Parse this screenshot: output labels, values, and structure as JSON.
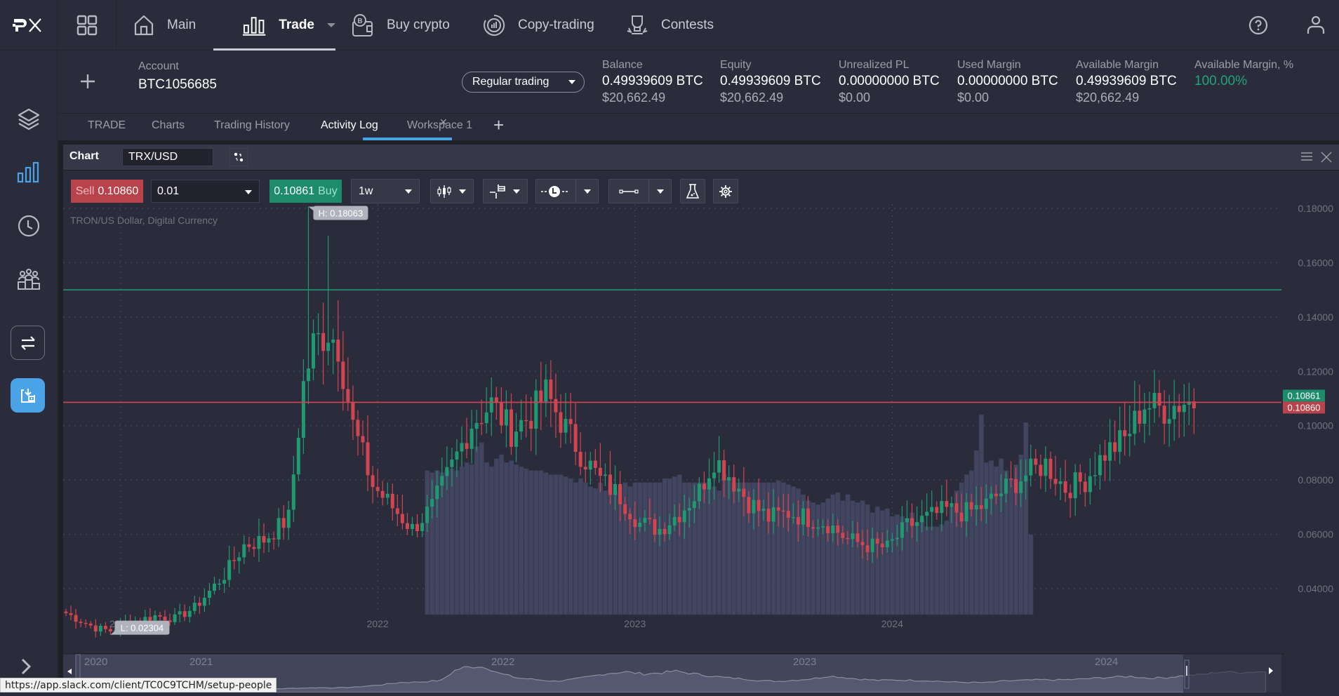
{
  "topbar": {
    "logo": "PX",
    "nav": [
      {
        "label": "Main",
        "icon": "home-icon"
      },
      {
        "label": "Trade",
        "icon": "bar-chart-icon",
        "active": true,
        "has_dropdown": true
      },
      {
        "label": "Buy crypto",
        "icon": "wallet-bitcoin-icon"
      },
      {
        "label": "Copy-trading",
        "icon": "copy-trading-icon"
      },
      {
        "label": "Contests",
        "icon": "trophy-icon"
      }
    ],
    "right_icons": [
      "help-icon",
      "user-icon"
    ]
  },
  "sidebar": {
    "items": [
      {
        "icon": "layers-icon",
        "active": false
      },
      {
        "icon": "bar-chart-icon",
        "active": true
      },
      {
        "icon": "clock-icon",
        "active": false
      },
      {
        "icon": "community-icon",
        "active": false
      },
      {
        "icon": "transfer-icon",
        "active": false
      },
      {
        "icon": "deposit-icon",
        "active": true
      }
    ],
    "expand_icon": "chevron-right-icon"
  },
  "account": {
    "label": "Account",
    "value": "BTC1056685",
    "mode": "Regular trading",
    "stats": [
      {
        "label": "Balance",
        "btc": "0.49939609 BTC",
        "usd": "$20,662.49"
      },
      {
        "label": "Equity",
        "btc": "0.49939609 BTC",
        "usd": "$20,662.49"
      },
      {
        "label": "Unrealized PL",
        "btc": "0.00000000 BTC",
        "usd": "$0.00"
      },
      {
        "label": "Used Margin",
        "btc": "0.00000000 BTC",
        "usd": "$0.00"
      },
      {
        "label": "Available Margin",
        "btc": "0.49939609 BTC",
        "usd": "$20,662.49"
      },
      {
        "label": "Available Margin, %",
        "value": "100.00%"
      }
    ]
  },
  "tabs": [
    {
      "label": "TRADE"
    },
    {
      "label": "Charts"
    },
    {
      "label": "Trading History"
    },
    {
      "label": "Activity Log",
      "active": true,
      "closable": true
    },
    {
      "label": "Workspace 1"
    }
  ],
  "chart_panel": {
    "title": "Chart",
    "symbol": "TRX/USD",
    "sell_label": "Sell",
    "sell_price": "0.10860",
    "quantity": "0.01",
    "buy_label": "Buy",
    "buy_price": "0.10861",
    "timeframe": "1w",
    "instrument_desc": "TRON/US Dollar, Digital Currency",
    "high_label": "H: 0.18063",
    "low_label": "L: 0.02304"
  },
  "chart_data": {
    "type": "candlestick",
    "title": "TRON/US Dollar, Digital Currency",
    "interval": "1w",
    "ylim": [
      0.0275,
      0.185
    ],
    "yticks": [
      "0.18000",
      "0.16000",
      "0.14000",
      "0.12000",
      "0.10000",
      "0.08000",
      "0.06000",
      "0.04000"
    ],
    "xticks": [
      "2021",
      "2022",
      "2023",
      "2024"
    ],
    "navigator_ticks": [
      "2020",
      "2021",
      "2022",
      "2023",
      "2024"
    ],
    "ask_price": 0.10861,
    "bid_price": 0.1086,
    "ask_label": "0.10861",
    "bid_label": "0.10860",
    "horizontal_line": 0.15,
    "high": 0.18063,
    "low": 0.02304,
    "colors": {
      "up": "#1f9a70",
      "down": "#d0454f",
      "volume": "#414560",
      "ask": "#1c8c6b",
      "bid": "#b8434c"
    },
    "anchor_points": [
      [
        0,
        0.031
      ],
      [
        6,
        0.0255
      ],
      [
        9,
        0.0245
      ],
      [
        12,
        0.027
      ],
      [
        18,
        0.03
      ],
      [
        22,
        0.029
      ],
      [
        26,
        0.033
      ],
      [
        32,
        0.045
      ],
      [
        36,
        0.056
      ],
      [
        40,
        0.058
      ],
      [
        45,
        0.066
      ],
      [
        48,
        0.115
      ],
      [
        50,
        0.13
      ],
      [
        53,
        0.135
      ],
      [
        55,
        0.13
      ],
      [
        58,
        0.1
      ],
      [
        62,
        0.078
      ],
      [
        66,
        0.07
      ],
      [
        70,
        0.062
      ],
      [
        74,
        0.07
      ],
      [
        78,
        0.085
      ],
      [
        82,
        0.101
      ],
      [
        86,
        0.108
      ],
      [
        90,
        0.098
      ],
      [
        94,
        0.104
      ],
      [
        97,
        0.112
      ],
      [
        100,
        0.102
      ],
      [
        104,
        0.09
      ],
      [
        108,
        0.08
      ],
      [
        112,
        0.074
      ],
      [
        116,
        0.064
      ],
      [
        120,
        0.062
      ],
      [
        124,
        0.068
      ],
      [
        128,
        0.076
      ],
      [
        131,
        0.088
      ],
      [
        134,
        0.082
      ],
      [
        138,
        0.072
      ],
      [
        142,
        0.066
      ],
      [
        146,
        0.068
      ],
      [
        150,
        0.066
      ],
      [
        154,
        0.064
      ],
      [
        158,
        0.058
      ],
      [
        162,
        0.056
      ],
      [
        166,
        0.055
      ],
      [
        170,
        0.063
      ],
      [
        174,
        0.066
      ],
      [
        178,
        0.069
      ],
      [
        182,
        0.068
      ],
      [
        186,
        0.071
      ],
      [
        190,
        0.077
      ],
      [
        194,
        0.082
      ],
      [
        198,
        0.086
      ],
      [
        202,
        0.077
      ],
      [
        206,
        0.08
      ],
      [
        210,
        0.09
      ],
      [
        214,
        0.095
      ],
      [
        218,
        0.108
      ],
      [
        222,
        0.106
      ],
      [
        226,
        0.109
      ],
      [
        228,
        0.1086
      ]
    ],
    "volume_start_index": 73,
    "volume_profile": [
      0.72,
      0.71,
      0.72,
      0.71,
      0.72,
      0.73,
      0.72,
      0.74,
      0.76,
      0.75,
      0.84,
      0.86,
      0.76,
      0.74,
      0.78,
      0.8,
      0.76,
      0.77,
      0.75,
      0.74,
      0.73,
      0.72,
      0.72,
      0.72,
      0.71,
      0.7,
      0.7,
      0.7,
      0.69,
      0.68,
      0.66,
      0.68,
      0.66,
      0.64,
      0.63,
      0.66,
      0.62,
      0.66,
      0.62,
      0.64,
      0.66,
      0.64,
      0.66,
      0.66,
      0.66,
      0.66,
      0.66,
      0.66,
      0.68,
      0.68,
      0.69,
      0.7,
      0.66,
      0.66,
      0.66,
      0.66,
      0.66,
      0.66,
      0.64,
      0.62,
      0.7,
      0.68,
      0.66,
      0.66,
      0.66,
      0.66,
      0.66,
      0.66,
      0.66,
      0.66,
      0.66,
      0.67,
      0.66,
      0.65,
      0.64,
      0.63,
      0.6,
      0.57,
      0.56,
      0.55,
      0.56,
      0.58,
      0.6,
      0.61,
      0.57,
      0.6,
      0.57,
      0.56,
      0.57,
      0.55,
      0.51,
      0.54,
      0.52,
      0.53,
      0.49,
      0.5,
      0.49,
      0.48,
      0.51,
      0.46,
      0.48,
      0.44,
      0.44,
      0.44,
      0.45,
      0.47,
      0.54,
      0.62,
      0.66,
      0.7,
      0.72,
      0.82,
      1.0,
      0.76,
      0.77,
      0.74,
      0.78,
      0.72,
      0.68,
      0.75,
      0.8,
      0.96,
      0.4
    ]
  },
  "status_url": "https://app.slack.com/client/TC0C9TCHM/setup-people"
}
